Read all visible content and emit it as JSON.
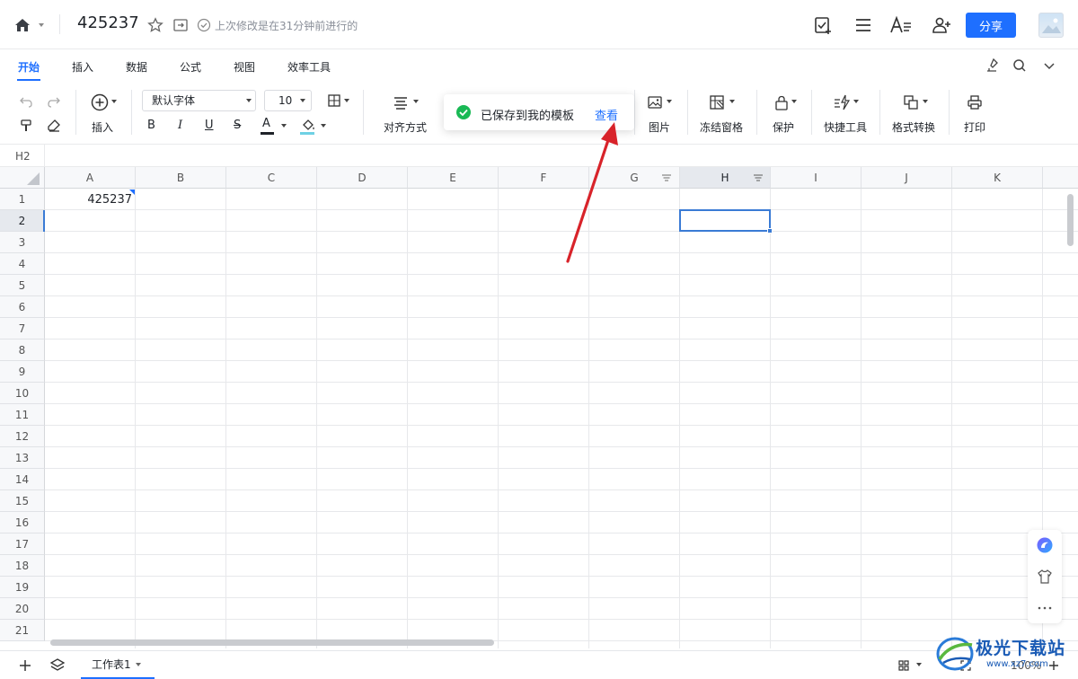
{
  "titlebar": {
    "doc_title": "425237",
    "saved_hint": "上次修改是在31分钟前进行的",
    "share_label": "分享",
    "font_icon_label": "A≡"
  },
  "menu": {
    "tabs": [
      {
        "label": "开始",
        "active": true
      },
      {
        "label": "插入"
      },
      {
        "label": "数据"
      },
      {
        "label": "公式"
      },
      {
        "label": "视图"
      },
      {
        "label": "效率工具"
      }
    ]
  },
  "ribbon": {
    "insert_label": "插入",
    "font_name": "默认字体",
    "font_size": "10",
    "bold": "B",
    "italic": "I",
    "underline": "U",
    "strike": "S",
    "font_color_letter": "A",
    "align_label": "对齐方式",
    "image_label": "图片",
    "freeze_label": "冻结窗格",
    "protect_label": "保护",
    "quick_tools_label": "快捷工具",
    "format_convert_label": "格式转换",
    "print_label": "打印",
    "accent_color": "#1e6fff"
  },
  "toast": {
    "message": "已保存到我的模板",
    "link": "查看",
    "status_color": "#19b955"
  },
  "formula_bar": {
    "cell_ref": "H2"
  },
  "grid": {
    "columns": [
      "A",
      "B",
      "C",
      "D",
      "E",
      "F",
      "G",
      "H",
      "I",
      "J",
      "K"
    ],
    "rows": [
      "1",
      "2",
      "3",
      "4",
      "5",
      "6",
      "7",
      "8",
      "9",
      "10",
      "11",
      "12",
      "13",
      "14",
      "15",
      "16",
      "17",
      "18",
      "19",
      "20",
      "21"
    ],
    "cell_a1": "425237",
    "selected_column": "H",
    "selected_row": "2"
  },
  "bottombar": {
    "sheet_tab": "工作表1",
    "zoom": "100%"
  },
  "watermark": {
    "text": "极光下载站",
    "url": "www.xz7.com"
  }
}
